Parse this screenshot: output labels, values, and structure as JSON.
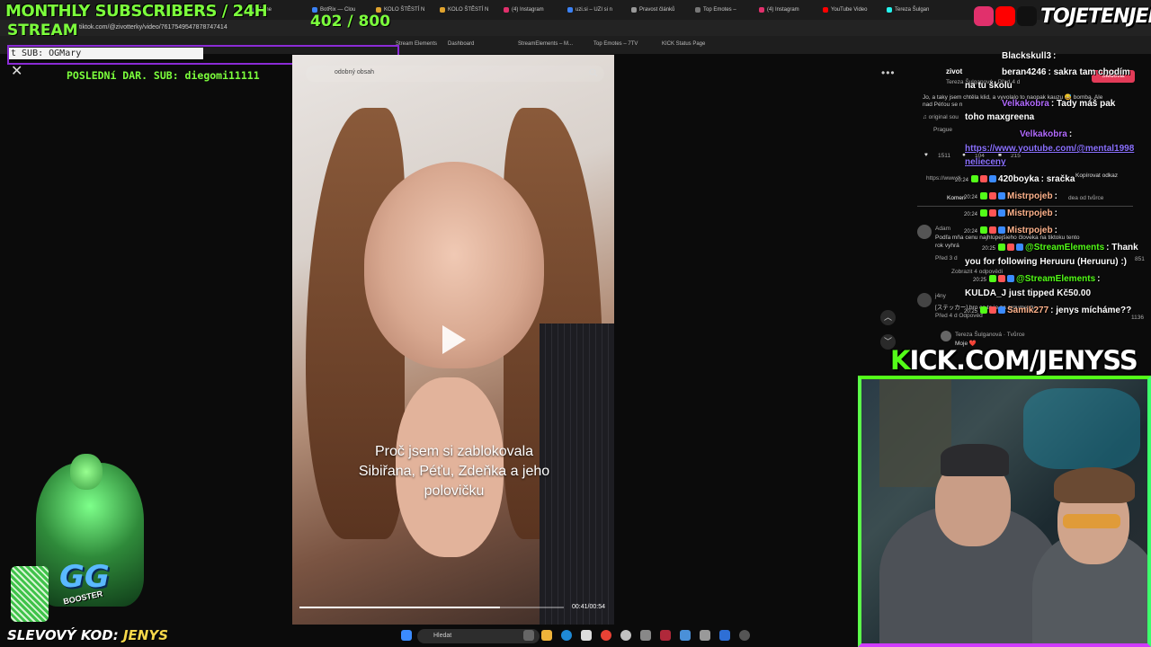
{
  "browser": {
    "tabs": [
      {
        "label": "Eleme",
        "color": "#7a66ff"
      },
      {
        "label": "BotRix — Clou",
        "color": "#3b82f6"
      },
      {
        "label": "KOLO ŠTĚSTÍ N",
        "color": "#e0a32e"
      },
      {
        "label": "KOLO ŠTĚSTÍ N",
        "color": "#e0a32e"
      },
      {
        "label": "(4) Instagram",
        "color": "#e1306c"
      },
      {
        "label": "uzi.si – UZI si n",
        "color": "#3b82f6"
      },
      {
        "label": "Pravost článků",
        "color": "#999999"
      },
      {
        "label": "Top Emotes –",
        "color": "#777777"
      },
      {
        "label": "(4) Instagram",
        "color": "#e1306c"
      },
      {
        "label": "YouTube Video",
        "color": "#ff0000"
      },
      {
        "label": "Tereza Šulgan",
        "color": "#25f4ee"
      }
    ],
    "url": "tiktok.com/@zivotterky/video/7617549547878747414",
    "bookmarks": [
      "Stream Elements",
      "Dashboard",
      "StreamElements – M...",
      "Top Emotes – 7TV",
      "KICK Status Page"
    ]
  },
  "overlay": {
    "monthly_title": "MONTHLY SUBSCRIBERS / 24H",
    "stream_word": "STREAM",
    "counter": "402  / 800",
    "last_sub": "t SUB: OGMary",
    "last_donation": "POSLEDNí DAR. SUB: diegomi11111"
  },
  "video": {
    "search_placeholder": "odobný obsah",
    "caption": "Proč jsem si zablokovala Sibiřana, Péťu, Zdeňka a jeho polovičku",
    "time": "00:41/00:54",
    "progress": 0.759,
    "close_glyph": "✕",
    "more_glyph": "•••",
    "up_glyph": "︿",
    "down_glyph": "﹀"
  },
  "tiktok": {
    "author": "zivot",
    "author_sub": "Tereza Šulganová · Před 4 d",
    "follow": "Sledovat",
    "desc1": "Jo, a taky jsem chtěla klid, a vyvolalo to naopak kauzu 😅 bomba. Ale",
    "desc2": "nad Péťou se n",
    "sound": "♫ original sou",
    "place": "Prague",
    "likes": "1511",
    "comments": "104",
    "saves": "215",
    "link_short": "https://www.ti",
    "copy_link": "Kopírovat odkaz",
    "comments_tab": "Komen",
    "creator_like": "dea od tvůrce",
    "c1_user": "Adam",
    "c1_text": "Podľa mňa cenu najhlúpejšieho človeka na tiktoku tento",
    "c1_text2": "rok vyhrá",
    "c1_meta": "Před 3 d",
    "c1_likes": "851",
    "c1_replies": "Zobrazit 4 odpovědi",
    "c2_user": "j4ny",
    "c2_text": "[ステッカー] bro co to je za argumenty",
    "c2_meta": "Před 4 d    Odpověď",
    "c2_likes": "1136",
    "c3_user": "Tereza Šulganová · Tvůrce",
    "c3_text": "Moje ❤️"
  },
  "chat": [
    {
      "time": "",
      "name": "Blackskull3",
      "color": "#ffffff",
      "msg": ":"
    },
    {
      "time": "",
      "name": "beran4246",
      "color": "#ffffff",
      "msg": ": sakra tam chodím"
    },
    {
      "time": "",
      "name": "",
      "color": "#ffffff",
      "msg": "na tu školu"
    },
    {
      "time": "",
      "name": "Velkakobra",
      "color": "#b36bff",
      "msg": ": Tady máš pak"
    },
    {
      "time": "",
      "name": "",
      "color": "#ffffff",
      "msg": "toho maxgreena"
    },
    {
      "time": "",
      "name": "Velkakobra",
      "color": "#b36bff",
      "msg": ":"
    },
    {
      "time": "",
      "name": "",
      "color": "#8c72ff",
      "msg": "https://www.youtube.com/@mental1998"
    },
    {
      "time": "",
      "name": "",
      "color": "#8c72ff",
      "msg": "nelieceny"
    },
    {
      "time": "20:24",
      "name": "420boyka",
      "color": "#ffffff",
      "msg": ": sračka"
    },
    {
      "time": "20:24",
      "name": "Mistrpojeb",
      "color": "#ffb38c",
      "msg": ":"
    },
    {
      "time": "20:24",
      "name": "Mistrpojeb",
      "color": "#ffb38c",
      "msg": ":"
    },
    {
      "time": "20:24",
      "name": "Mistrpojeb",
      "color": "#ffb38c",
      "msg": ":"
    },
    {
      "time": "20:25",
      "name": "@StreamElements",
      "color": "#53fc18",
      "msg": ": Thank"
    },
    {
      "time": "",
      "name": "",
      "color": "#ffffff",
      "msg": "you for following Heruuru (Heruuru) :)"
    },
    {
      "time": "20:25",
      "name": "@StreamElements",
      "color": "#53fc18",
      "msg": ":"
    },
    {
      "time": "",
      "name": "",
      "color": "#ffffff",
      "msg": "KULDA_J just tipped Kč50.00"
    },
    {
      "time": "20:25",
      "name": "Samik277",
      "color": "#ffb38c",
      "msg": ": jenys mícháme??"
    }
  ],
  "social": {
    "name": "TOJETENJENYS",
    "icons": [
      {
        "name": "instagram-icon",
        "color": "#e1306c"
      },
      {
        "name": "youtube-icon",
        "color": "#ff0000"
      },
      {
        "name": "tiktok-icon",
        "color": "#111111"
      }
    ]
  },
  "kick": {
    "k": "K",
    "rest": "ICK.COM/JENYSS"
  },
  "bottom": {
    "coupon_label": "SLEVOVÝ KOD:",
    "coupon_code": "JENYS",
    "taskbar_search": "Hledat",
    "booster": "BOOSTER",
    "gg": "GG"
  }
}
